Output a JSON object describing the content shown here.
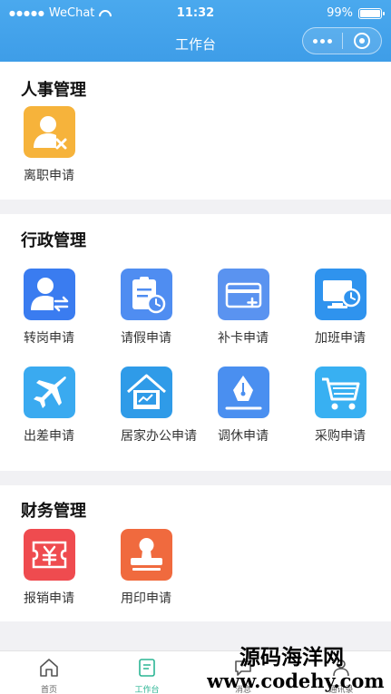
{
  "status": {
    "carrier": "WeChat",
    "time": "11:32",
    "battery": "99%"
  },
  "nav": {
    "title": "工作台"
  },
  "sections": [
    {
      "title": "人事管理",
      "apps": [
        {
          "label": "离职申请",
          "icon": "resign-icon",
          "color": "#f6b33b"
        }
      ]
    },
    {
      "title": "行政管理",
      "apps": [
        {
          "label": "转岗申请",
          "icon": "transfer-icon",
          "color": "#3a7cf0"
        },
        {
          "label": "请假申请",
          "icon": "leave-icon",
          "color": "#4f8df1"
        },
        {
          "label": "补卡申请",
          "icon": "card-icon",
          "color": "#5a93f0"
        },
        {
          "label": "加班申请",
          "icon": "overtime-icon",
          "color": "#2f93ee"
        },
        {
          "label": "出差申请",
          "icon": "plane-icon",
          "color": "#3aaaf0"
        },
        {
          "label": "居家办公申请",
          "icon": "home-office-icon",
          "color": "#2f9be8"
        },
        {
          "label": "调休申请",
          "icon": "pen-icon",
          "color": "#4a8ff0"
        },
        {
          "label": "采购申请",
          "icon": "cart-icon",
          "color": "#38b0f2"
        }
      ]
    },
    {
      "title": "财务管理",
      "apps": [
        {
          "label": "报销申请",
          "icon": "reimburse-icon",
          "color": "#ef4b4f"
        },
        {
          "label": "用印申请",
          "icon": "seal-icon",
          "color": "#f06a3e"
        }
      ]
    }
  ],
  "tabs": [
    {
      "label": "首页",
      "icon": "home-icon"
    },
    {
      "label": "工作台",
      "icon": "workbench-icon",
      "active": true
    },
    {
      "label": "消息",
      "icon": "message-icon"
    },
    {
      "label": "通讯录",
      "icon": "contacts-icon"
    }
  ],
  "watermark": {
    "line1": "源码海洋网",
    "line2": "www.codehy.com"
  },
  "colors": {
    "header": "#3e9de8",
    "active_tab": "#2bb594",
    "background": "#f1f1f4"
  }
}
